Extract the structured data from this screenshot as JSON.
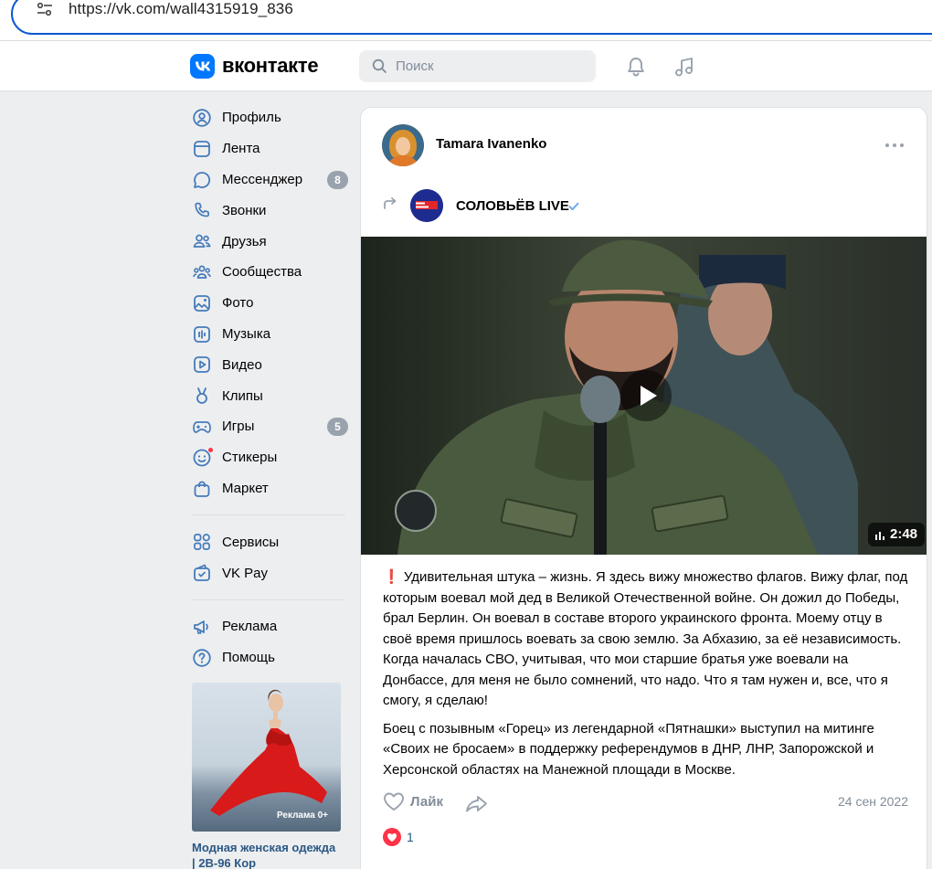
{
  "browser": {
    "url": "https://vk.com/wall4315919_836"
  },
  "header": {
    "brand": "вконтакте",
    "search_placeholder": "Поиск"
  },
  "sidebar": {
    "items": [
      {
        "label": "Профиль",
        "icon": "profile-icon"
      },
      {
        "label": "Лента",
        "icon": "news-icon"
      },
      {
        "label": "Мессенджер",
        "icon": "messenger-icon",
        "badge": "8"
      },
      {
        "label": "Звонки",
        "icon": "phone-icon"
      },
      {
        "label": "Друзья",
        "icon": "friends-icon"
      },
      {
        "label": "Сообщества",
        "icon": "communities-icon"
      },
      {
        "label": "Фото",
        "icon": "photo-icon"
      },
      {
        "label": "Музыка",
        "icon": "music-icon"
      },
      {
        "label": "Видео",
        "icon": "video-icon"
      },
      {
        "label": "Клипы",
        "icon": "clips-icon"
      },
      {
        "label": "Игры",
        "icon": "games-icon",
        "badge": "5"
      },
      {
        "label": "Стикеры",
        "icon": "stickers-icon"
      },
      {
        "label": "Маркет",
        "icon": "market-icon"
      }
    ],
    "items2": [
      {
        "label": "Сервисы",
        "icon": "services-icon"
      },
      {
        "label": "VK Pay",
        "icon": "vkpay-icon"
      }
    ],
    "items3": [
      {
        "label": "Реклама",
        "icon": "ads-icon"
      },
      {
        "label": "Помощь",
        "icon": "help-icon"
      }
    ],
    "ad": {
      "label": "Реклама 0+",
      "title": "Модная женская одежда | 2B-96 Кор"
    }
  },
  "post": {
    "author": "Tamara Ivanenko",
    "source": "СОЛОВЬЁВ LIVE",
    "video_duration": "2:48",
    "paragraph1": "❗ Удивительная штука – жизнь. Я здесь вижу множество флагов. Вижу флаг, под которым воевал мой дед в Великой Отечественной войне. Он дожил до Победы, брал Берлин. Он воевал в составе второго украинского фронта. Моему отцу в своё время пришлось воевать за свою землю. За Абхазию, за её независимость. Когда началась СВО, учитывая, что мои старшие братья уже воевали на Донбассе, для меня не было сомнений, что надо. Что я там нужен и, все, что я смогу, я сделаю!",
    "paragraph2": "Боец с позывным «Горец» из легендарной «Пятнашки» выступил на митинге «Своих не бросаем» в поддержку референдумов в ДНР, ЛНР, Запорожской и Херсонской областях на Манежной площади в Москве.",
    "like_label": "Лайк",
    "date": "24 сен 2022",
    "reactions_count": "1"
  },
  "colors": {
    "accent": "#0077ff",
    "link": "#2a5885",
    "muted": "#818c99",
    "heart": "#ff3347"
  }
}
